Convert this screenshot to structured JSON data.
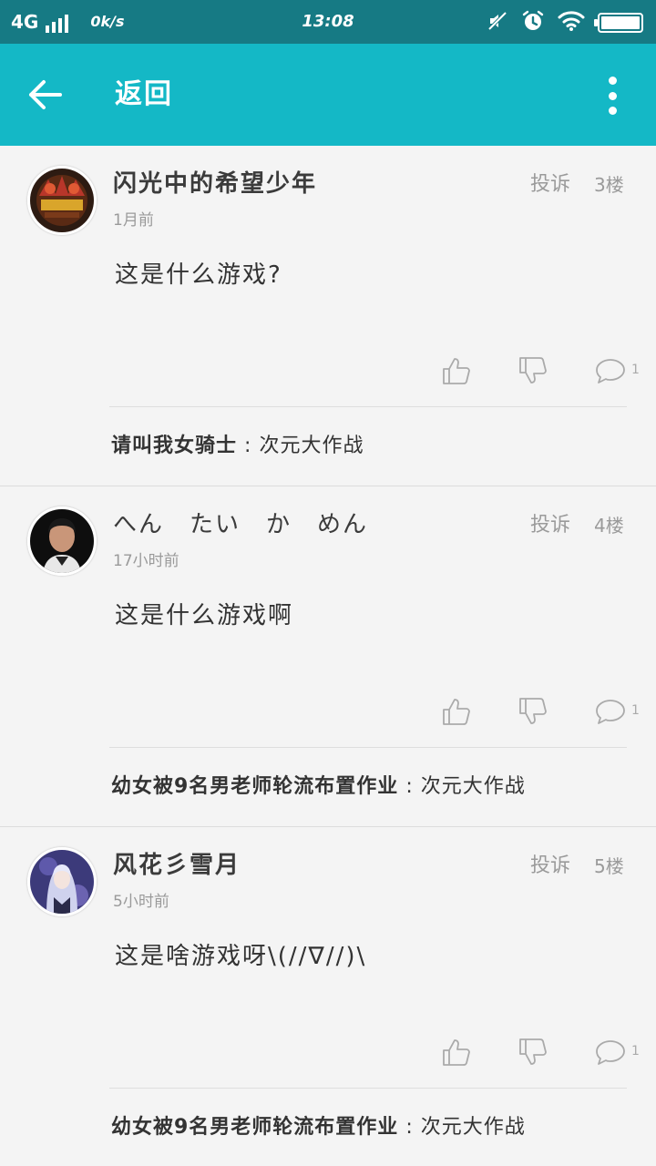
{
  "status_bar": {
    "network": "4G",
    "speed": "0k/s",
    "time": "13:08"
  },
  "app_bar": {
    "back_icon": "arrow-left-icon",
    "title": "返回",
    "menu_icon": "more-vertical-icon",
    "background_color": "#14b8c6"
  },
  "comments": [
    {
      "username": "闪光中的希望少年",
      "report_label": "投诉",
      "floor": "3楼",
      "time": "1月前",
      "content": "这是什么游戏?",
      "reply_count": "1",
      "source_user": "请叫我女骑士",
      "source_separator": ":",
      "source_title": "次元大作战"
    },
    {
      "username": "へん　たい　か　めん",
      "report_label": "投诉",
      "floor": "4楼",
      "time": "17小时前",
      "content": "这是什么游戏啊",
      "reply_count": "1",
      "source_user": "幼女被9名男老师轮流布置作业",
      "source_separator": ":",
      "source_title": "次元大作战"
    },
    {
      "username": "风花彡雪月",
      "report_label": "投诉",
      "floor": "5楼",
      "time": "5小时前",
      "content": "这是啥游戏呀\\(//∇//)\\",
      "reply_count": "1",
      "source_user": "幼女被9名男老师轮流布置作业",
      "source_separator": ":",
      "source_title": "次元大作战"
    }
  ]
}
